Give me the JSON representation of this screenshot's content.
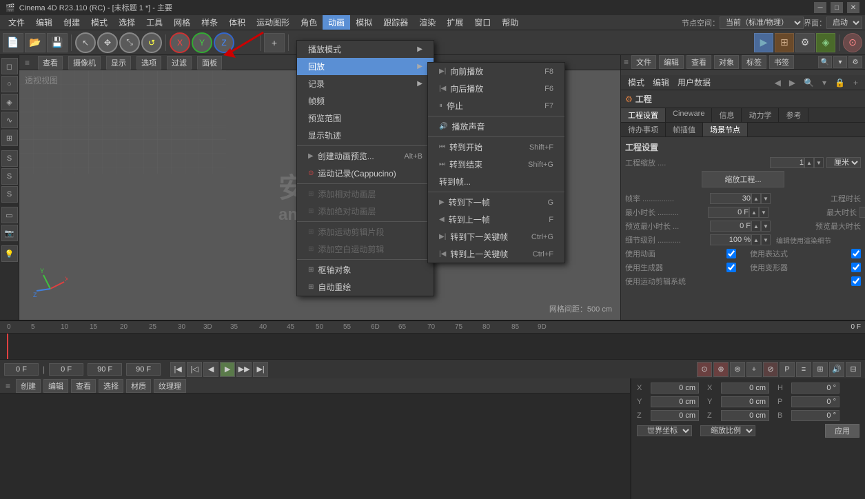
{
  "titlebar": {
    "title": "Cinema 4D R23.110 (RC) - [未标题 1 *] - 主要",
    "icon": "🎬"
  },
  "menubar": {
    "items": [
      "文件",
      "编辑",
      "创建",
      "模式",
      "选择",
      "工具",
      "网格",
      "样条",
      "体积",
      "运动图形",
      "角色",
      "动画",
      "模拟",
      "跟踪器",
      "渲染",
      "扩展",
      "窗口",
      "帮助"
    ]
  },
  "toolbar": {
    "node_space_label": "节点空间：",
    "node_space_value": "当前（标准/物理）",
    "interface_label": "界面：",
    "interface_value": "启动"
  },
  "anim_menu": {
    "playback_mode": "播放模式",
    "playback": "回放",
    "record": "记录",
    "frame": "帧频",
    "preview_range": "预览范围",
    "show_track": "显示轨迹",
    "create_preview": "创建动画预览...",
    "create_preview_shortcut": "Alt+B",
    "motion_record": "运动记录(Cappucino)",
    "add_relative_layer": "添加相对动画层",
    "add_absolute_layer": "添加绝对动画层",
    "add_motion_clip": "添加运动剪辑片段",
    "add_empty_clip": "添加空白运动剪辑",
    "pivot_object": "枢轴对象",
    "auto_redraw": "自动重绘"
  },
  "playback_submenu": {
    "forward": "向前播放",
    "forward_shortcut": "F8",
    "backward": "向后播放",
    "backward_shortcut": "F6",
    "stop": "停止",
    "stop_shortcut": "F7",
    "play_sound": "播放声音",
    "go_start": "转到开始",
    "go_start_shortcut": "Shift+F",
    "go_end": "转到结束",
    "go_end_shortcut": "Shift+G",
    "go_to_frame": "转到帧...",
    "next_frame": "转到下一帧",
    "next_frame_shortcut": "G",
    "prev_frame": "转到上一帧",
    "prev_frame_shortcut": "F",
    "next_keyframe": "转到下一关键帧",
    "next_keyframe_shortcut": "Ctrl+G",
    "prev_keyframe": "转到上一关键帧",
    "prev_keyframe_shortcut": "Ctrl+F"
  },
  "viewport": {
    "label": "透视视图",
    "toolbar": [
      "查看",
      "摄像机",
      "显示",
      "选项",
      "过滤",
      "面板"
    ],
    "grid_distance": "网格间距：500 cm"
  },
  "timeline": {
    "current_frame": "0 F",
    "end_frame": "90 F",
    "markers": [
      "0",
      "5",
      "10",
      "15",
      "20",
      "25",
      "30",
      "3D",
      "35",
      "40",
      "45",
      "50",
      "55",
      "6D",
      "65",
      "70",
      "75",
      "80",
      "85",
      "9D"
    ],
    "playback_controls": [
      "⏮",
      "⏭",
      "◀",
      "▶",
      "▶▶",
      "⏭"
    ],
    "frame_input": "0 F",
    "start_input": "0 F",
    "end_input": "90 F"
  },
  "lower_toolbar": {
    "items": [
      "创建",
      "编辑",
      "查看",
      "选择",
      "材质",
      "纹理"
    ]
  },
  "coordinates": {
    "x_pos": "0 cm",
    "y_pos": "0 cm",
    "z_pos": "0 cm",
    "x_rot": "0 °",
    "y_rot": "0 °",
    "z_rot": "0 °",
    "h_val": "0 °",
    "p_val": "0 °",
    "b_val": "0 °",
    "coord_system": "世界坐标",
    "scale": "缩放比例",
    "apply_btn": "应用"
  },
  "right_panel": {
    "tabs": [
      "文件",
      "编辑",
      "查看",
      "对象",
      "标签",
      "书签"
    ],
    "search_placeholder": "搜索"
  },
  "properties": {
    "header": "工程",
    "tabs": [
      "工程设置",
      "Cineware",
      "信息",
      "动力学",
      "参考"
    ],
    "subtabs": [
      "待办事项",
      "帧插值",
      "场景节点"
    ],
    "section_title": "工程设置",
    "props": [
      {
        "label": "工程缩放 ....",
        "value": "1",
        "unit": "厘米"
      },
      {
        "label": "帧率 ...............",
        "value": "30"
      },
      {
        "label": "最小时长 ..........",
        "value": "0 F"
      },
      {
        "label": "预览最小时长 ...",
        "value": "0 F"
      },
      {
        "label": "细节级别 ...........",
        "value": "100 %"
      },
      {
        "label": "使用动画",
        "check": true
      },
      {
        "label": "使用生成器",
        "check": true
      },
      {
        "label": "使用运动剪辑系统",
        "check": true
      }
    ],
    "scale_btn": "缩放工程...",
    "max_time_label": "工程时长",
    "max_time_value": "",
    "preview_max_label": "预览最大时长",
    "preview_max_value": "",
    "detail_right_label": "编辑使用渲染细节",
    "use_expressions_label": "使用表达式",
    "use_expressions_check": true,
    "use_deformers_label": "使用变形器",
    "use_deformers_check": true
  },
  "watermark": {
    "text": "安下载",
    "subtext": "anxz.com"
  }
}
